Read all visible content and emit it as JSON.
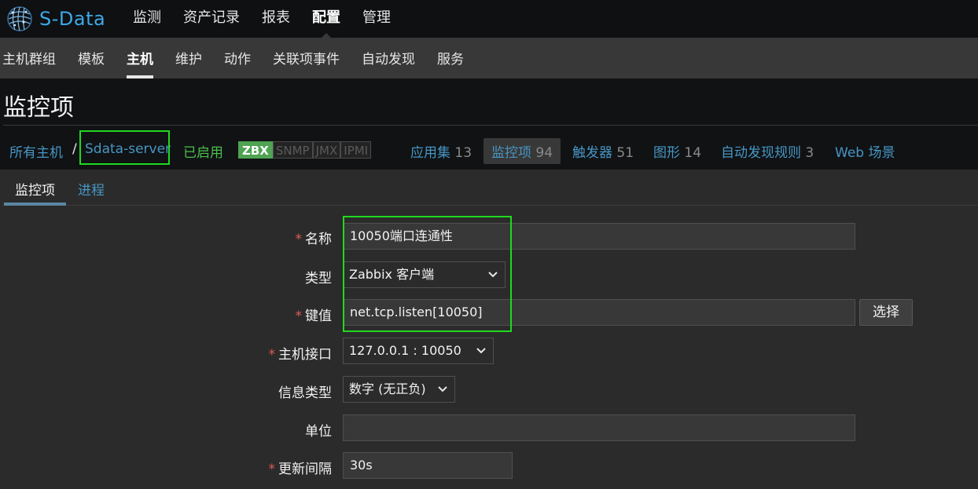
{
  "brand": {
    "name": "S-Data"
  },
  "main_menu": [
    {
      "label": "监测",
      "active": false
    },
    {
      "label": "资产记录",
      "active": false
    },
    {
      "label": "报表",
      "active": false
    },
    {
      "label": "配置",
      "active": true
    },
    {
      "label": "管理",
      "active": false
    }
  ],
  "sub_menu": [
    {
      "label": "主机群组"
    },
    {
      "label": "模板"
    },
    {
      "label": "主机",
      "active": true
    },
    {
      "label": "维护"
    },
    {
      "label": "动作"
    },
    {
      "label": "关联项事件"
    },
    {
      "label": "自动发现"
    },
    {
      "label": "服务"
    }
  ],
  "page": {
    "title": "监控项"
  },
  "breadcrumb": {
    "all_hosts": "所有主机",
    "separator": "/",
    "host": "Sdata-server",
    "status": "已启用",
    "availability": [
      "ZBX",
      "SNMP",
      "JMX",
      "IPMI"
    ],
    "links": [
      {
        "label": "应用集",
        "count": "13"
      },
      {
        "label": "监控项",
        "count": "94",
        "current": true
      },
      {
        "label": "触发器",
        "count": "51"
      },
      {
        "label": "图形",
        "count": "14"
      },
      {
        "label": "自动发现规则",
        "count": "3"
      },
      {
        "label": "Web 场景",
        "count": ""
      }
    ]
  },
  "tabs": [
    {
      "label": "监控项",
      "active": true
    },
    {
      "label": "进程",
      "active": false
    }
  ],
  "form": {
    "name": {
      "label": "名称",
      "required": "*",
      "value": "10050端口连通性"
    },
    "type": {
      "label": "类型",
      "value": "Zabbix 客户端"
    },
    "key": {
      "label": "键值",
      "required": "*",
      "value": "net.tcp.listen[10050]",
      "button": "选择"
    },
    "interface": {
      "label": "主机接口",
      "required": "*",
      "value": "127.0.0.1 : 10050"
    },
    "info_type": {
      "label": "信息类型",
      "value": "数字 (无正负)"
    },
    "units": {
      "label": "单位",
      "value": ""
    },
    "interval": {
      "label": "更新间隔",
      "required": "*",
      "value": "30s"
    }
  },
  "colors": {
    "accent_link": "#4796c4",
    "highlight": "#1fd91f",
    "enabled": "#4cbe4c",
    "required": "#e45959",
    "zbx_badge": "#4fa352"
  }
}
